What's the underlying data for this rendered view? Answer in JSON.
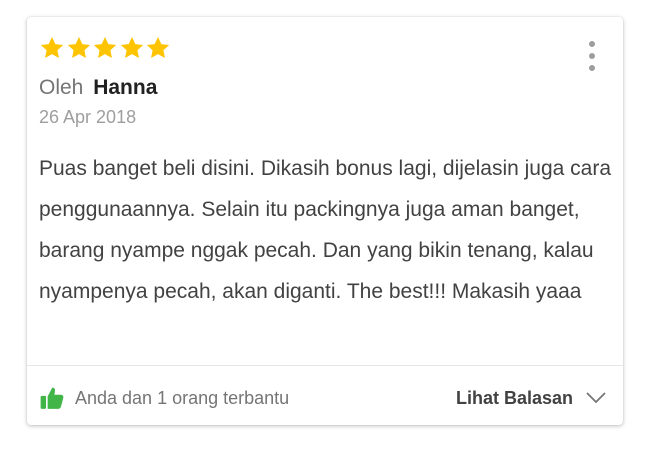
{
  "review": {
    "rating": 5,
    "rating_max": 5,
    "by_prefix": "Oleh",
    "author": "Hanna",
    "date": "26 Apr 2018",
    "text": "Puas banget beli disini. Dikasih bonus lagi, dijelasin juga cara penggunaannya. Selain itu packingnya juga aman banget, barang nyampe nggak pecah. Dan yang bikin tenang, kalau nyampenya pecah, akan diganti. The best!!! Makasih yaaa",
    "helpful_text": "Anda dan 1 orang terbantu",
    "replies_label": "Lihat Balasan"
  },
  "icons": {
    "star": "star-icon",
    "more": "more-vertical-icon",
    "thumb": "thumbs-up-icon",
    "chevron": "chevron-down-icon"
  },
  "colors": {
    "star": "#FFC400",
    "thumb": "#42B549",
    "text_primary": "#212121",
    "text_secondary": "#757575"
  }
}
